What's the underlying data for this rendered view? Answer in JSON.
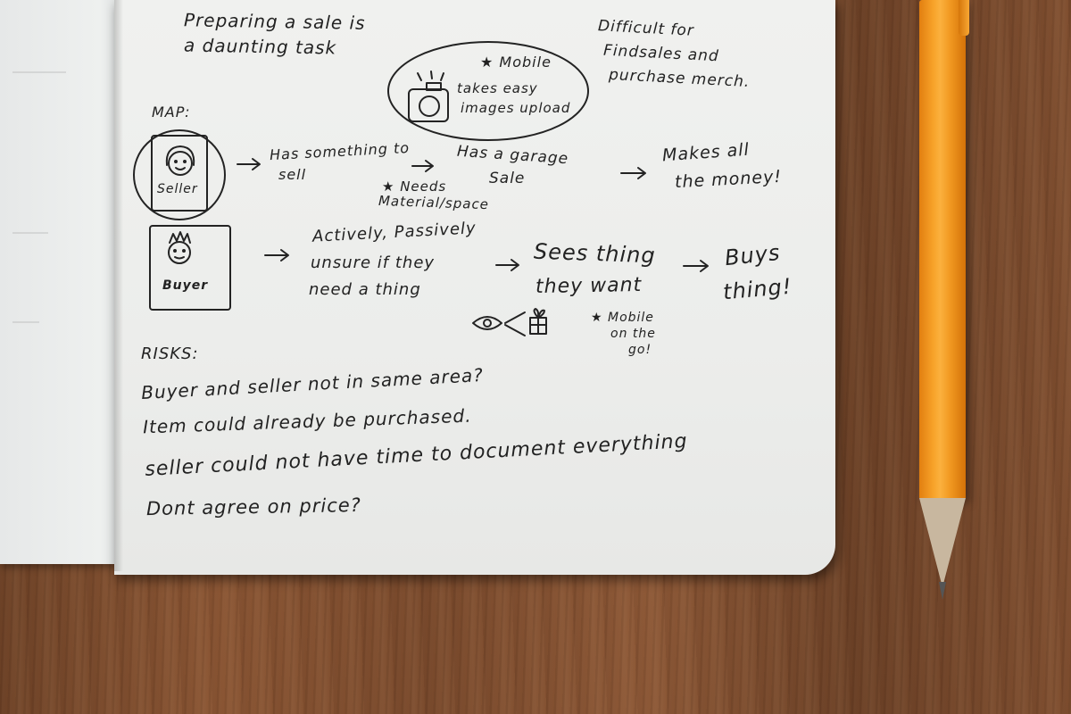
{
  "notes": {
    "heading1": "Preparing a sale is",
    "heading2": "a daunting task",
    "difficult1": "Difficult for",
    "difficult2": "Findsales and",
    "difficult3": "purchase merch.",
    "mobile_note": "★ Mobile",
    "camera_note1": "takes easy",
    "camera_note2": "images upload",
    "map_label": "MAP:",
    "seller_label": "Seller",
    "seller_step1a": "Has something to",
    "seller_step1b": "sell",
    "seller_step2a": "Has a garage",
    "seller_step2b": "Sale",
    "seller_need1": "★ Needs",
    "seller_need2": "Material/space",
    "seller_step3a": "Makes all",
    "seller_step3b": "the money!",
    "buyer_label": "Buyer",
    "buyer_step1a": "Actively, Passively",
    "buyer_step1b": "unsure if they",
    "buyer_step1c": "need a thing",
    "buyer_step2a": "Sees thing",
    "buyer_step2b": "they want",
    "buyer_mobile1": "★ Mobile",
    "buyer_mobile2": "on the",
    "buyer_mobile3": "go!",
    "buyer_step3a": "Buys",
    "buyer_step3b": "thing!",
    "risks_label": "RISKS:",
    "risk1": "Buyer and seller not in same area?",
    "risk2": "Item could already be purchased.",
    "risk3": "seller could not have time to document everything",
    "risk4": "Dont agree on price?"
  },
  "colors": {
    "ink": "#222222",
    "page": "#eeefed",
    "pencil": "#f59e25",
    "wood": "#7d4c2e"
  }
}
